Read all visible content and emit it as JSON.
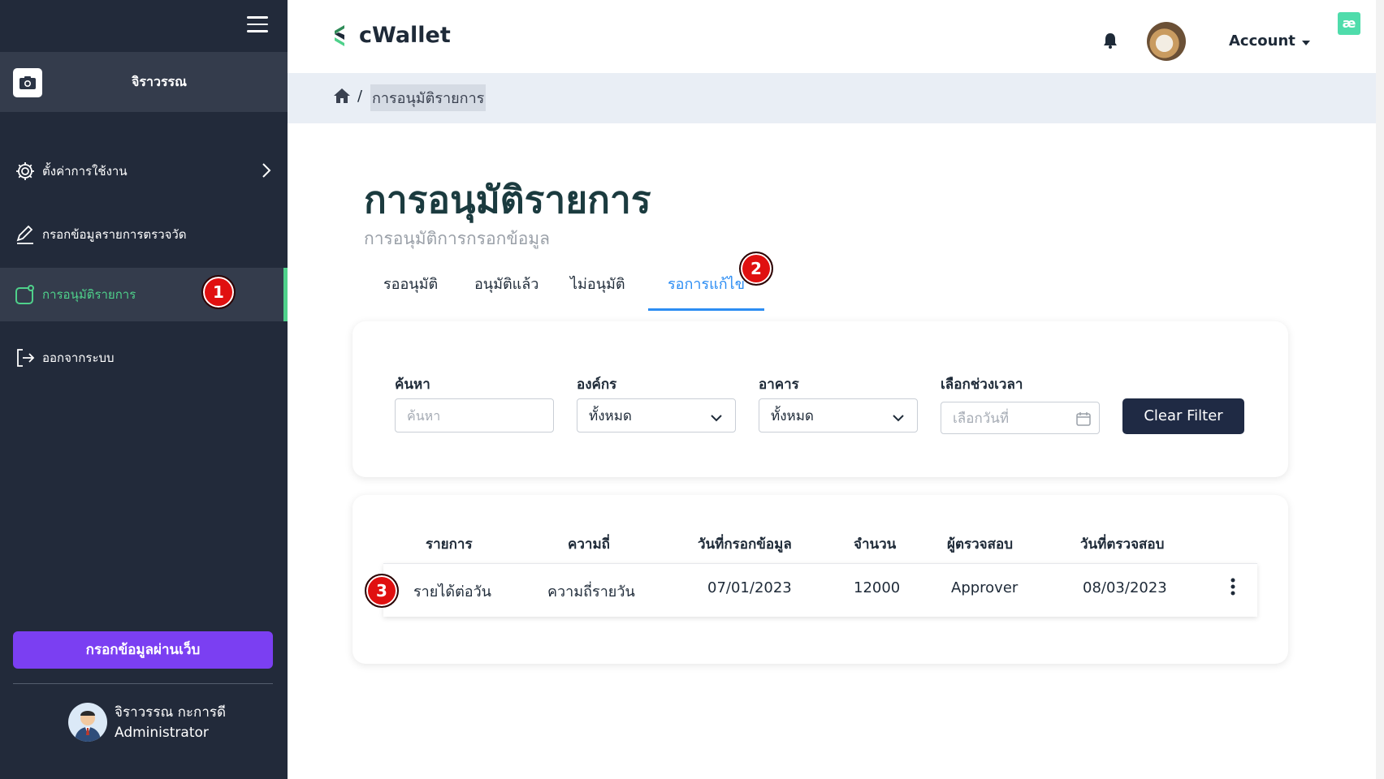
{
  "app": {
    "logo_text": "cWallet",
    "account_label": "Account"
  },
  "sidebar": {
    "profile_name": "จิราวรรณ",
    "items": [
      {
        "label": "ตั้งค่าการใช้งาน"
      },
      {
        "label": "กรอกข้อมูลรายการตรวจวัด"
      },
      {
        "label": "การอนุมัติรายการ"
      },
      {
        "label": "ออกจากระบบ"
      }
    ],
    "web_button_label": "กรอกข้อมูลผ่านเว็บ",
    "user": {
      "name": "จิราวรรณ กะการดี",
      "role": "Administrator"
    }
  },
  "breadcrumb": {
    "separator": "/",
    "current": "การอนุมัติรายการ"
  },
  "page": {
    "title": "การอนุมัติรายการ",
    "subtitle": "การอนุมัติการกรอกข้อมูล"
  },
  "tabs": [
    {
      "label": "รออนุมัติ"
    },
    {
      "label": "อนุมัติแล้ว"
    },
    {
      "label": "ไม่อนุมัติ"
    },
    {
      "label": "รอการแก้ไข",
      "active": true
    }
  ],
  "filters": {
    "search": {
      "label": "ค้นหา",
      "placeholder": "ค้นหา"
    },
    "org": {
      "label": "องค์กร",
      "value": "ทั้งหมด"
    },
    "building": {
      "label": "อาคาร",
      "value": "ทั้งหมด"
    },
    "date": {
      "label": "เลือกช่วงเวลา",
      "placeholder": "เลือกวันที่"
    },
    "clear_label": "Clear Filter"
  },
  "table": {
    "headers": [
      "รายการ",
      "ความถี่",
      "วันที่กรอกข้อมูล",
      "จำนวน",
      "ผู้ตรวจสอบ",
      "วันที่ตรวจสอบ"
    ],
    "rows": [
      [
        "รายได้ต่อวัน",
        "ความถี่รายวัน",
        "07/01/2023",
        "12000",
        "Approver",
        "08/03/2023"
      ]
    ]
  },
  "annotations": [
    "1",
    "2",
    "3"
  ],
  "colors": {
    "sidebar_bg": "#222a3a",
    "accent_green": "#4fd18b",
    "tab_active": "#2c8df3",
    "web_button": "#7b3ff2",
    "badge": "#e01010",
    "clear_button": "#1f2a44"
  }
}
